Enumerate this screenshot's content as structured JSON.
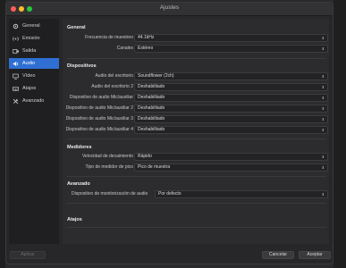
{
  "window": {
    "title": "Ajustes"
  },
  "sidebar": {
    "items": [
      {
        "label": "General",
        "icon": "gear-icon"
      },
      {
        "label": "Emisión",
        "icon": "broadcast-icon"
      },
      {
        "label": "Salida",
        "icon": "output-icon"
      },
      {
        "label": "Audio",
        "icon": "speaker-icon",
        "active": true
      },
      {
        "label": "Vídeo",
        "icon": "monitor-icon"
      },
      {
        "label": "Atajos",
        "icon": "keyboard-icon"
      },
      {
        "label": "Avanzado",
        "icon": "tools-icon"
      }
    ]
  },
  "general": {
    "header": "General",
    "rows": [
      {
        "label": "Frecuencia de muestreo",
        "value": "44.1kHz"
      },
      {
        "label": "Canales",
        "value": "Estéreo"
      }
    ]
  },
  "devices": {
    "header": "Dispositivos",
    "rows": [
      {
        "label": "Audio del escritorio",
        "value": "Soundflower (2ch)"
      },
      {
        "label": "Audio del escritorio 2",
        "value": "Deshabilitado"
      },
      {
        "label": "Dispositivo de audio Mic/auxiliar",
        "value": "Deshabilitado"
      },
      {
        "label": "Dispositivo de audio Mic/auxiliar 2",
        "value": "Deshabilitado"
      },
      {
        "label": "Dispositivo de audio Mic/auxiliar 3",
        "value": "Deshabilitado"
      },
      {
        "label": "Dispositivo de audio Mic/auxiliar 4",
        "value": "Deshabilitado"
      }
    ]
  },
  "meters": {
    "header": "Medidores",
    "rows": [
      {
        "label": "Velocidad de decaimiento",
        "value": "Rápido"
      },
      {
        "label": "Tipo de medidor de pico",
        "value": "Pico de muestra"
      }
    ]
  },
  "advanced": {
    "header": "Avanzado",
    "monitor_label": "Dispositivo de monitorización de audio",
    "monitor_value": "Por defecto"
  },
  "hotkeys": {
    "header": "Atajos"
  },
  "footer": {
    "apply_left": "Aplicar",
    "cancel": "Cancelar",
    "accept": "Aceptar"
  }
}
